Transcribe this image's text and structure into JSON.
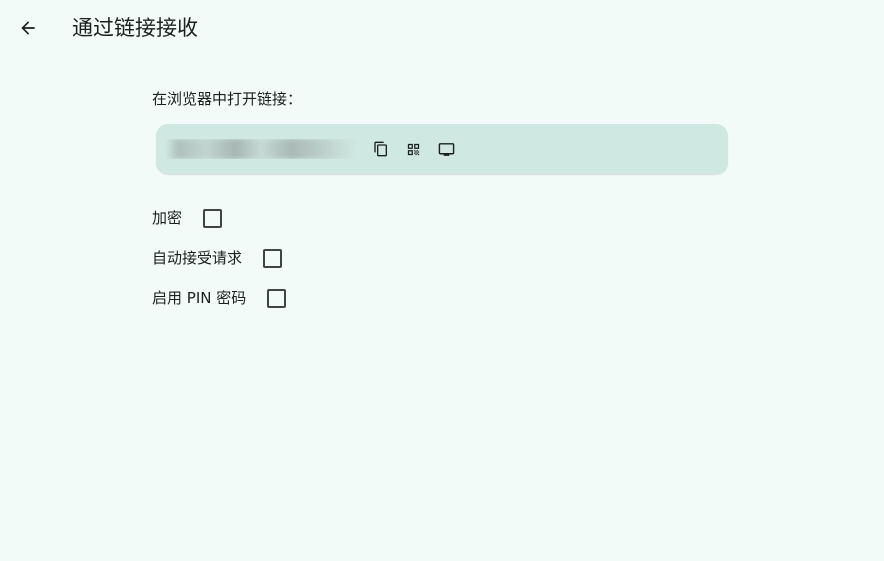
{
  "header": {
    "back_icon": "arrow-left-icon",
    "title": "通过链接接收"
  },
  "link_section": {
    "label": "在浏览器中打开链接：",
    "url": "",
    "icons": [
      "copy-icon",
      "qr-code-icon",
      "screen-icon"
    ]
  },
  "options": [
    {
      "label": "加密",
      "checked": false
    },
    {
      "label": "自动接受请求",
      "checked": false
    },
    {
      "label": "启用 PIN 密码",
      "checked": false
    }
  ],
  "colors": {
    "background": "#f3fbf8",
    "card": "#cfe8e2",
    "text": "#1b1f1e",
    "checkbox_border": "#3e4644"
  }
}
